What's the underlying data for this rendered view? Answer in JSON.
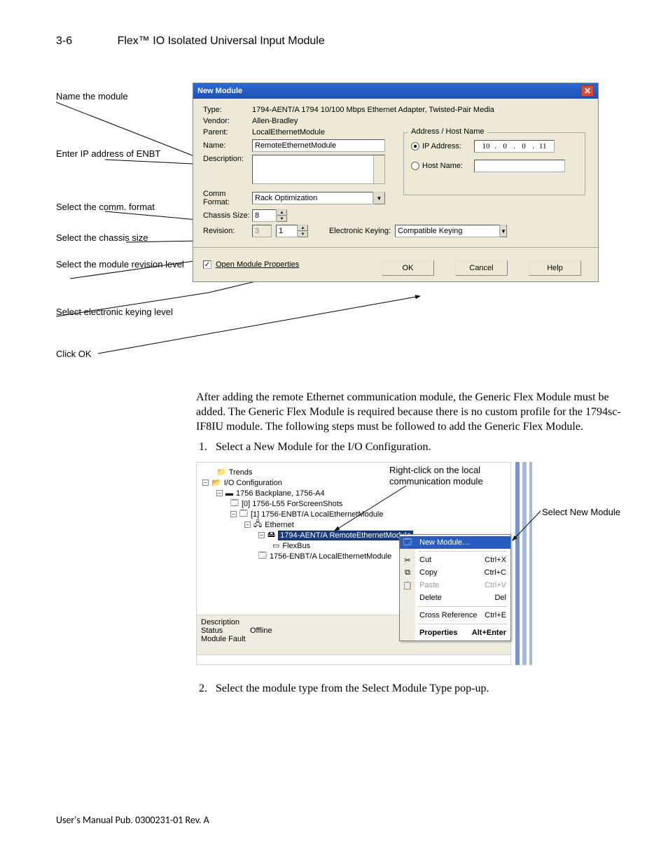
{
  "header": {
    "page_num": "3-6",
    "title": "Flex™ IO Isolated Universal Input Module"
  },
  "callouts1": {
    "c1": "Name the module",
    "c2": "Enter IP address of ENBT",
    "c3": "Select the comm. format",
    "c4": "Select the chassis size",
    "c5": "Select the module revision level",
    "c6": "Select electronic keying level",
    "c7": "Click OK"
  },
  "dialog": {
    "title": "New Module",
    "labels": {
      "type": "Type:",
      "vendor": "Vendor:",
      "parent": "Parent:",
      "name": "Name:",
      "description": "Description:",
      "commformat": "Comm Format:",
      "chassis": "Chassis Size:",
      "revision": "Revision:",
      "ekey": "Electronic Keying:"
    },
    "values": {
      "type": "1794-AENT/A 1794 10/100 Mbps Ethernet Adapter, Twisted-Pair Media",
      "vendor": "Allen-Bradley",
      "parent": "LocalEthernetModule",
      "name": "RemoteEthernetModule",
      "commformat": "Rack Optimization",
      "chassis": "8",
      "rev_major": "3",
      "rev_minor": "1",
      "ekey": "Compatible Keying"
    },
    "group": {
      "title": "Address / Host Name",
      "ip_label": "IP Address:",
      "host_label": "Host Name:",
      "ip": [
        "10",
        "0",
        "0",
        "11"
      ]
    },
    "open_props": "Open Module Properties",
    "buttons": {
      "ok": "OK",
      "cancel": "Cancel",
      "help": "Help"
    }
  },
  "para1": "After adding the remote Ethernet communication module, the Generic Flex Module must be added.  The Generic Flex Module is required because there is no custom profile for the 1794sc-IF8IU module.  The following steps must be followed to add the Generic Flex Module.",
  "step1": "Select a New Module for the I/O Configuration.",
  "tree": {
    "n0": "Trends",
    "n1": "I/O Configuration",
    "n2": "1756 Backplane, 1756-A4",
    "n3": "[0] 1756-L55 ForScreenShots",
    "n4": "[1] 1756-ENBT/A LocalEthernetModule",
    "n5": "Ethernet",
    "n6": "1794-AENT/A RemoteEthernetModule",
    "n7": "FlexBus",
    "n8": "1756-ENBT/A LocalEthernetModule"
  },
  "status": {
    "labels": {
      "desc": "Description",
      "status": "Status",
      "fault": "Module Fault"
    },
    "values": {
      "status": "Offline"
    }
  },
  "ctx": {
    "new_module": "New Module…",
    "cut": "Cut",
    "cut_k": "Ctrl+X",
    "copy": "Copy",
    "copy_k": "Ctrl+C",
    "paste": "Paste",
    "paste_k": "Ctrl+V",
    "delete": "Delete",
    "delete_k": "Del",
    "xref": "Cross Reference",
    "xref_k": "Ctrl+E",
    "props": "Properties",
    "props_k": "Alt+Enter"
  },
  "fig2": {
    "callout1a": "Right-click on the local",
    "callout1b": "communication module",
    "callout2": "Select New Module"
  },
  "step2": "Select the module type from the Select Module Type pop-up.",
  "footer": "User's Manual Pub. 0300231-01 Rev. A"
}
